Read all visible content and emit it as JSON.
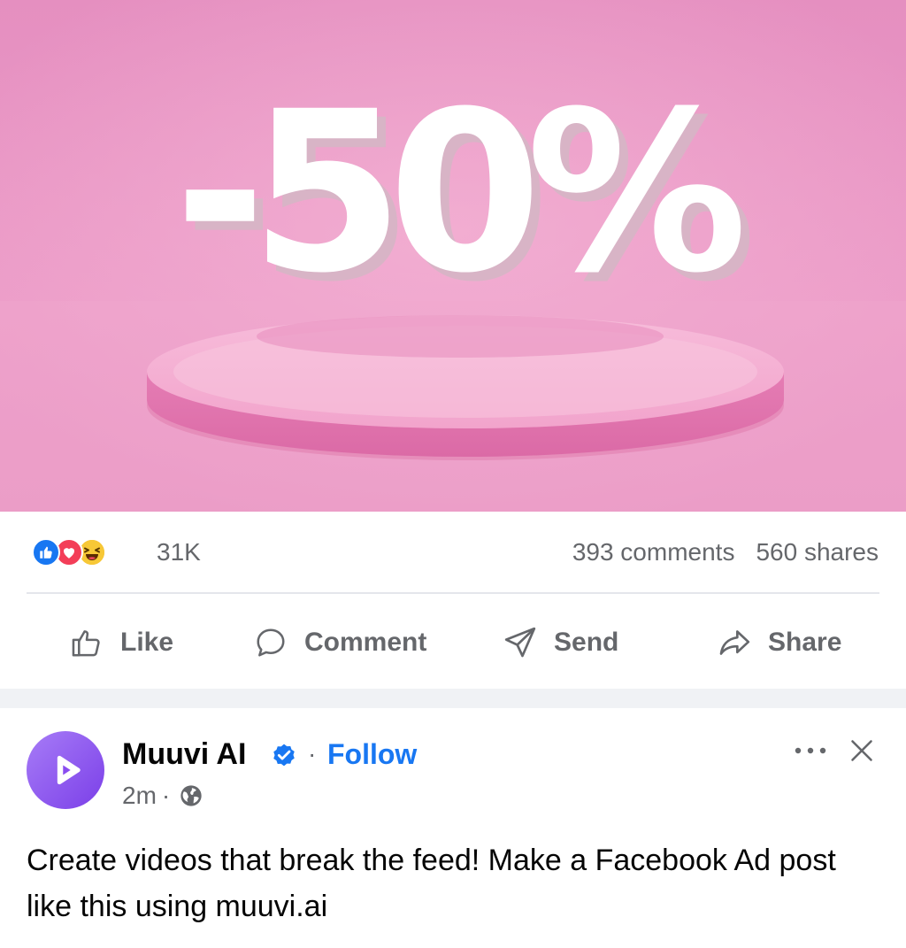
{
  "hero": {
    "discount_text": "-50%"
  },
  "stats": {
    "reaction_icons": [
      "like-icon",
      "love-icon",
      "haha-icon"
    ],
    "reaction_count": "31K",
    "comments": "393 comments",
    "shares": "560 shares"
  },
  "actions": {
    "like": "Like",
    "comment": "Comment",
    "send": "Send",
    "share": "Share"
  },
  "post": {
    "page_name": "Muuvi AI",
    "follow": "Follow",
    "dot": "·",
    "time": "2m",
    "text": "Create videos that break the feed! Make a Facebook Ad post like this using muuvi.ai"
  },
  "colors": {
    "brand_blue": "#1877f2",
    "muted_text": "#65676b",
    "hero_pink": "#e98cbd"
  }
}
